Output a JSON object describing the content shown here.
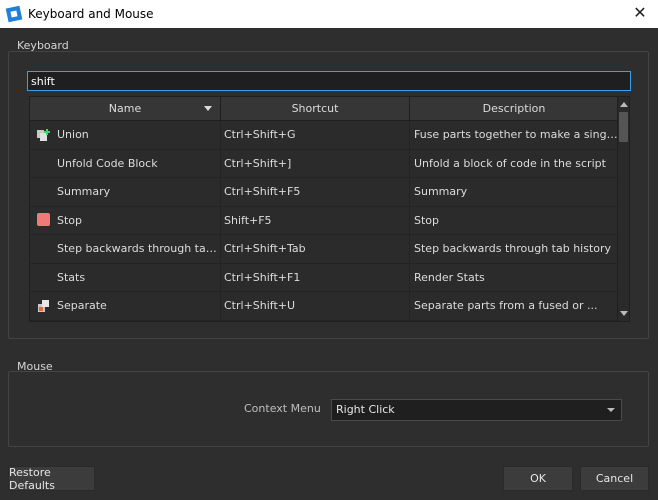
{
  "window": {
    "title": "Keyboard and Mouse"
  },
  "keyboard": {
    "group_label": "Keyboard",
    "search": {
      "value": "shift",
      "placeholder": ""
    },
    "columns": [
      "Name",
      "Shortcut",
      "Description"
    ],
    "sort_column": "Name",
    "rows": [
      {
        "icon": "union-icon",
        "name": "Union",
        "shortcut": "Ctrl+Shift+G",
        "description": "Fuse parts together to make a single part"
      },
      {
        "icon": "",
        "name": "Unfold Code Block",
        "shortcut": "Ctrl+Shift+]",
        "description": "Unfold a block of code in the script"
      },
      {
        "icon": "",
        "name": "Summary",
        "shortcut": "Ctrl+Shift+F5",
        "description": "Summary"
      },
      {
        "icon": "stop-icon",
        "name": "Stop",
        "shortcut": "Shift+F5",
        "description": "Stop"
      },
      {
        "icon": "",
        "name": "Step backwards through tab ...",
        "shortcut": "Ctrl+Shift+Tab",
        "description": "Step backwards through tab history"
      },
      {
        "icon": "",
        "name": "Stats",
        "shortcut": "Ctrl+Shift+F1",
        "description": "Render Stats"
      },
      {
        "icon": "separate-icon",
        "name": "Separate",
        "shortcut": "Ctrl+Shift+U",
        "description": "Separate parts from a fused or ..."
      }
    ]
  },
  "mouse": {
    "group_label": "Mouse",
    "context_menu_label": "Context Menu",
    "context_menu_value": "Right Click"
  },
  "buttons": {
    "restore_defaults": "Restore Defaults",
    "ok": "OK",
    "cancel": "Cancel"
  },
  "colors": {
    "background": "#2e2e2e",
    "accent": "#3aa0e8",
    "stop": "#f07a7a"
  }
}
